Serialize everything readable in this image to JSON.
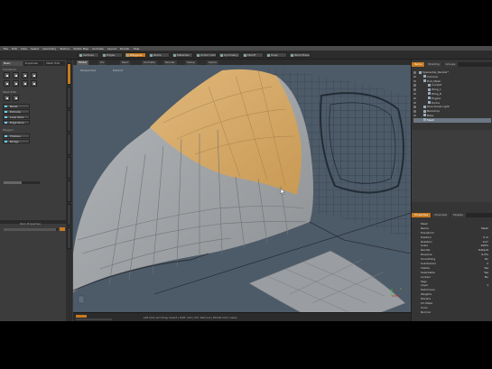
{
  "menu": [
    "File",
    "Edit",
    "View",
    "Select",
    "Geometry",
    "Texture",
    "Vertex Map",
    "Animate",
    "Layout",
    "Render",
    "Help"
  ],
  "toolbar": {
    "buttons": [
      {
        "label": "Vertices",
        "active": false
      },
      {
        "label": "Edges",
        "active": false
      },
      {
        "label": "Polygons",
        "active": true
      },
      {
        "label": "Items",
        "active": false
      },
      {
        "label": "Materials",
        "active": false
      },
      {
        "label": "Action Center",
        "active": false
      },
      {
        "label": "Symmetry",
        "active": false
      },
      {
        "label": "Falloff",
        "active": false
      },
      {
        "label": "Snap",
        "active": false
      },
      {
        "label": "Work Plane",
        "active": false
      }
    ]
  },
  "left_panel": {
    "tabs": [
      "Basic",
      "Duplicate",
      "Mesh Edit"
    ],
    "section_label": "Transform",
    "section2_label": "Mesh Edit",
    "section3_label": "Polygon",
    "buttons": [
      "Bevel",
      "Extrude",
      "Loop Slice",
      "Edge Slice",
      "Thicken",
      "Bridge"
    ],
    "footer_label": "Item Properties"
  },
  "viewport": {
    "tabs": [
      "Model",
      "UV",
      "Paint",
      "Animate",
      "Render",
      "Setup",
      "Game"
    ],
    "view_label": "Perspective",
    "shading_label": "Default",
    "axis_label": "Y",
    "status_text": "Left Click and Drag: Select  |  Shift: Add  |  Ctrl: Remove  |  Middle Click: Lasso"
  },
  "right_panel": {
    "tabs_top": [
      "Items",
      "Shading",
      "Groups"
    ],
    "tree": [
      {
        "label": "Spaceship_Render*",
        "indent": 0,
        "selected": false
      },
      {
        "label": "Camera",
        "indent": 1,
        "selected": false
      },
      {
        "label": "Hull_Mesh",
        "indent": 1,
        "selected": false
      },
      {
        "label": "Cockpit",
        "indent": 2,
        "selected": false
      },
      {
        "label": "Wing_L",
        "indent": 2,
        "selected": false
      },
      {
        "label": "Wing_R",
        "indent": 2,
        "selected": false
      },
      {
        "label": "Engine",
        "indent": 2,
        "selected": false
      },
      {
        "label": "Dome",
        "indent": 2,
        "selected": false
      },
      {
        "label": "Directional Light",
        "indent": 1,
        "selected": false
      },
      {
        "label": "Backdrop",
        "indent": 1,
        "selected": false
      },
      {
        "label": "Base",
        "indent": 1,
        "selected": false
      },
      {
        "label": "Mesh",
        "indent": 1,
        "selected": true
      }
    ],
    "tabs_bottom": [
      "Properties",
      "Channels",
      "Display"
    ],
    "props": [
      {
        "label": "Mesh",
        "value": ""
      },
      {
        "label": "Name",
        "value": "Mesh"
      },
      {
        "label": "Transform",
        "value": ""
      },
      {
        "label": "Position",
        "value": "0 m"
      },
      {
        "label": "Rotation",
        "value": "0.0°"
      },
      {
        "label": "Scale",
        "value": "100%"
      },
      {
        "label": "Render",
        "value": "Default"
      },
      {
        "label": "Dissolve",
        "value": "0.0%"
      },
      {
        "label": "Smoothing",
        "value": "On"
      },
      {
        "label": "Subdivision",
        "value": "2"
      },
      {
        "label": "Visible",
        "value": "Yes"
      },
      {
        "label": "Selectable",
        "value": "Yes"
      },
      {
        "label": "Locked",
        "value": "No"
      },
      {
        "label": "Tags",
        "value": ""
      },
      {
        "label": "Layer",
        "value": "1"
      },
      {
        "label": "Deformers",
        "value": ""
      },
      {
        "label": "Weights",
        "value": ""
      },
      {
        "label": "Morphs",
        "value": ""
      },
      {
        "label": "UV Maps",
        "value": ""
      },
      {
        "label": "Color",
        "value": ""
      },
      {
        "label": "Normal",
        "value": ""
      }
    ]
  },
  "colors": {
    "accent": "#c87a20",
    "selection": "#d9a865",
    "mesh": "#9a9fa4",
    "viewport_bg": "#4d5a68"
  }
}
